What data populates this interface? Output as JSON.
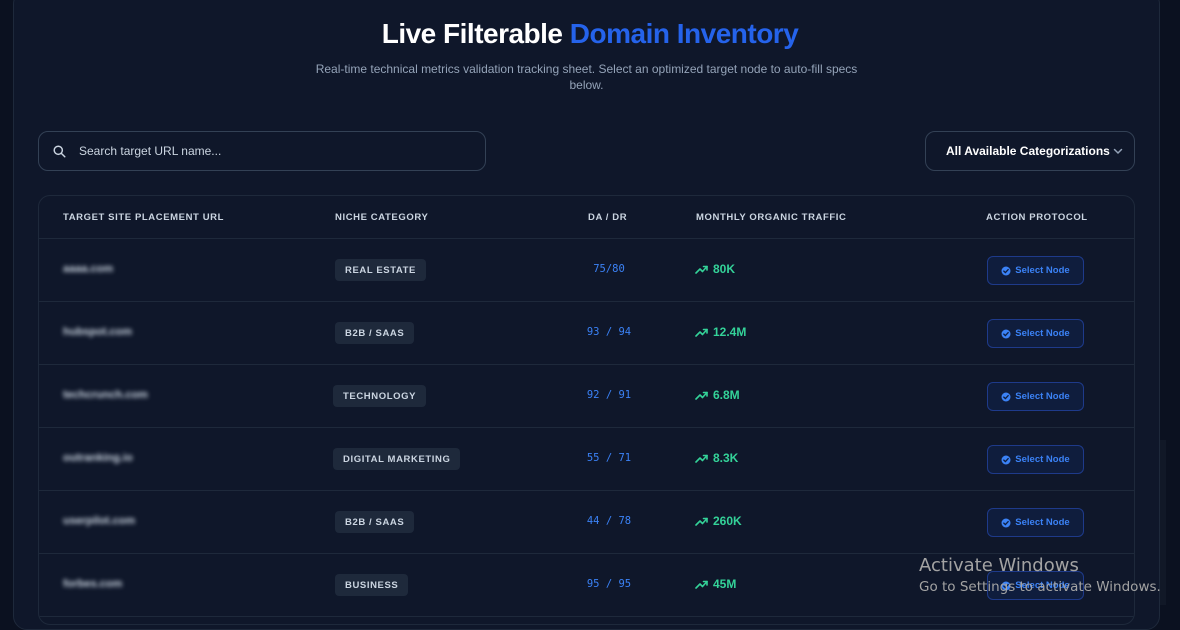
{
  "header": {
    "title_main": "Live Filterable",
    "title_accent": "Domain Inventory",
    "subtitle": "Real-time technical metrics validation tracking sheet. Select an optimized target node to auto-fill specs below."
  },
  "search": {
    "placeholder": "Search target URL name...",
    "value": ""
  },
  "filter": {
    "selected": "All Available Categorizations"
  },
  "table": {
    "columns": [
      "TARGET SITE PLACEMENT URL",
      "NICHE CATEGORY",
      "DA / DR",
      "MONTHLY ORGANIC TRAFFIC",
      "ACTION PROTOCOL"
    ],
    "rows": [
      {
        "url": "aaaa.com",
        "category": "REAL ESTATE",
        "da_dr": "75/80",
        "traffic": "80K",
        "action": "Select Node"
      },
      {
        "url": "hubspot.com",
        "category": "B2B / SAAS",
        "da_dr": "93 / 94",
        "traffic": "12.4M",
        "action": "Select Node"
      },
      {
        "url": "techcrunch.com",
        "category": "TECHNOLOGY",
        "da_dr": "92 / 91",
        "traffic": "6.8M",
        "action": "Select Node"
      },
      {
        "url": "outranking.io",
        "category": "DIGITAL MARKETING",
        "da_dr": "55 / 71",
        "traffic": "8.3K",
        "action": "Select Node"
      },
      {
        "url": "userpilot.com",
        "category": "B2B / SAAS",
        "da_dr": "44 / 78",
        "traffic": "260K",
        "action": "Select Node"
      },
      {
        "url": "forbes.com",
        "category": "BUSINESS",
        "da_dr": "95 / 95",
        "traffic": "45M",
        "action": "Select Node"
      }
    ]
  },
  "watermark": {
    "line1": "Activate Windows",
    "line2": "Go to Settings to activate Windows."
  },
  "colors": {
    "background": "#0b1120",
    "panel": "#0f172a",
    "accent": "#2563eb",
    "link": "#3b82f6",
    "traffic": "#34d399",
    "badge": "#1e293b"
  }
}
